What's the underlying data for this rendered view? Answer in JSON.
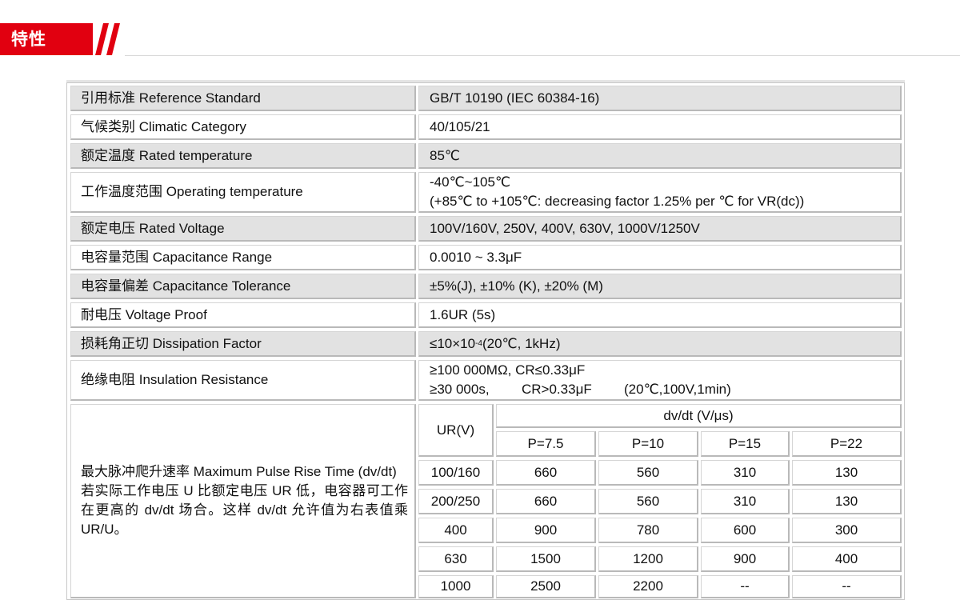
{
  "header": {
    "title": "特性",
    "accent_color": "#e10010"
  },
  "spec_rows": [
    {
      "label": "引用标准 Reference Standard",
      "value": "GB/T 10190 (IEC 60384-16)"
    },
    {
      "label": "气候类别 Climatic Category",
      "value": "40/105/21"
    },
    {
      "label": "额定温度 Rated temperature",
      "value": "85℃"
    },
    {
      "label": "工作温度范围 Operating temperature",
      "value_line1": "-40℃~105℃",
      "value_line2": "(+85℃ to +105℃: decreasing factor 1.25% per ℃ for VR(dc))"
    },
    {
      "label": "额定电压 Rated Voltage",
      "value": "100V/160V, 250V, 400V, 630V, 1000V/1250V"
    },
    {
      "label": "电容量范围 Capacitance Range",
      "value": "0.0010 ~ 3.3μF"
    },
    {
      "label": "电容量偏差 Capacitance Tolerance",
      "value": "±5%(J), ±10% (K), ±20% (M)"
    },
    {
      "label": "耐电压 Voltage Proof",
      "value": "1.6UR (5s)"
    },
    {
      "label": "损耗角正切 Dissipation Factor",
      "value_pre": "≤10×10",
      "value_sup": "-4",
      "value_post": "(20℃, 1kHz)"
    },
    {
      "label": "绝缘电阻 Insulation Resistance",
      "value_line1": "≥100 000MΩ, CR≤0.33μF",
      "value_line2_a": "≥30 000s,",
      "value_line2_b": "CR>0.33μF",
      "value_line2_c": "(20℃,100V,1min)"
    }
  ],
  "pulse": {
    "label_line1": "最大脉冲爬升速率 Maximum Pulse Rise Time (dv/dt)",
    "label_line2": "若实际工作电压 U 比额定电压 UR 低，电容器可工作在更高的 dv/dt 场合。这样 dv/dt 允许值为右表值乘 UR/U。",
    "col_ur": "UR(V)",
    "col_group": "dv/dt (V/μs)",
    "p_headers": [
      "P=7.5",
      "P=10",
      "P=15",
      "P=22"
    ],
    "rows": [
      {
        "ur": "100/160",
        "vals": [
          "660",
          "560",
          "310",
          "130"
        ]
      },
      {
        "ur": "200/250",
        "vals": [
          "660",
          "560",
          "310",
          "130"
        ]
      },
      {
        "ur": "400",
        "vals": [
          "900",
          "780",
          "600",
          "300"
        ]
      },
      {
        "ur": "630",
        "vals": [
          "1500",
          "1200",
          "900",
          "400"
        ]
      },
      {
        "ur": "1000",
        "vals": [
          "2500",
          "2200",
          "--",
          "--"
        ]
      }
    ]
  }
}
